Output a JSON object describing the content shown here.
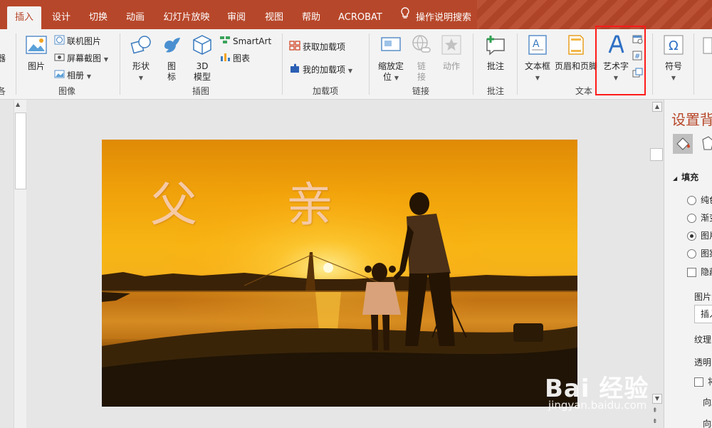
{
  "tabs": [
    {
      "label": "插入",
      "active": true
    },
    {
      "label": "设计"
    },
    {
      "label": "切换"
    },
    {
      "label": "动画"
    },
    {
      "label": "幻灯片放映"
    },
    {
      "label": "审阅"
    },
    {
      "label": "视图"
    },
    {
      "label": "帮助"
    },
    {
      "label": "ACROBAT"
    },
    {
      "label": "操作说明搜索"
    }
  ],
  "ribbon": {
    "images": {
      "picture": "图片",
      "online_picture": "联机图片",
      "screenshot": "屏幕截图",
      "album": "相册",
      "label": "图像"
    },
    "illustrations": {
      "shapes": "形状",
      "icons_line1": "图",
      "icons_line2": "标",
      "model_line1": "3D",
      "model_line2": "模型",
      "smartart": "SmartArt",
      "chart": "图表",
      "label": "插图"
    },
    "addins": {
      "get": "获取加载项",
      "mine": "我的加载项",
      "label": "加载项"
    },
    "links": {
      "zoom_line1": "缩放定",
      "zoom_line2": "位",
      "link_line1": "链",
      "link_line2": "接",
      "action": "动作",
      "label": "链接"
    },
    "comments": {
      "comment": "批注",
      "label": "批注"
    },
    "text": {
      "textbox": "文本框",
      "header_footer": "页眉和页脚",
      "wordart": "艺术字",
      "label": "文本"
    },
    "symbols": {
      "symbol": "符号"
    },
    "left_cut_label": "器",
    "left_cut_label2": "各"
  },
  "slide": {
    "title": "父 亲"
  },
  "watermark": {
    "brand": "Bai 经验",
    "url": "jingyan.baidu.com"
  },
  "panel": {
    "title": "设置背",
    "fill_section": "填充",
    "options": [
      {
        "label": "纯色",
        "checked": false
      },
      {
        "label": "渐变",
        "checked": false
      },
      {
        "label": "图片",
        "checked": true
      },
      {
        "label": "图案",
        "checked": false
      }
    ],
    "hide": "隐藏",
    "picture_source": "图片源",
    "insert": "插入",
    "texture": "纹理",
    "transparency": "透明",
    "tile": "将",
    "offset_left": "向左",
    "offset_right": "向右"
  },
  "colors": {
    "brand": "#b7472a",
    "highlight": "#ff1a1a"
  }
}
